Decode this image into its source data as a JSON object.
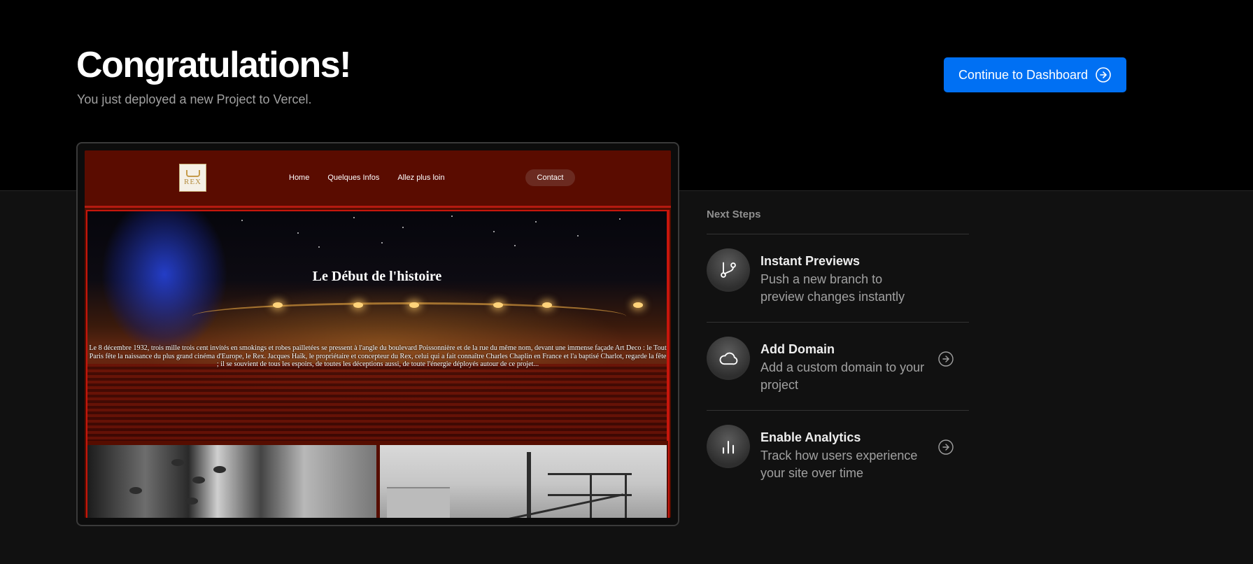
{
  "header": {
    "title": "Congratulations!",
    "subtitle": "You just deployed a new Project to Vercel.",
    "cta_label": "Continue to Dashboard",
    "cta_icon": "arrow-right-circle-icon",
    "accent_color": "#0070f3"
  },
  "preview": {
    "logo_text": "REX",
    "nav": [
      "Home",
      "Quelques Infos",
      "Allez plus loin"
    ],
    "contact_label": "Contact",
    "hero_title": "Le Début de l'histoire",
    "hero_text": "Le 8 décembre 1932, trois mille trois cent invités en smokings et robes pailletées se pressent à l'angle du boulevard Poissonnière et de la rue du même nom, devant une immense façade Art Deco : le Tout Paris fête la naissance du plus grand cinéma d'Europe, le Rex. Jacques Haïk, le propriétaire et concepteur du Rex, celui qui a fait connaître Charles Chaplin en France et l'a baptisé Charlot, regarde la fête ; il se souvient de tous les espoirs, de toutes les déceptions aussi, de toute l'énergie déployés autour de ce projet..."
  },
  "next_steps": {
    "title": "Next Steps",
    "items": [
      {
        "title": "Instant Previews",
        "desc": "Push a new branch to preview changes instantly",
        "icon": "git-branch-icon",
        "has_arrow": false
      },
      {
        "title": "Add Domain",
        "desc": "Add a custom domain to your project",
        "icon": "cloud-icon",
        "has_arrow": true
      },
      {
        "title": "Enable Analytics",
        "desc": "Track how users experience your site over time",
        "icon": "bar-chart-icon",
        "has_arrow": true
      }
    ]
  }
}
